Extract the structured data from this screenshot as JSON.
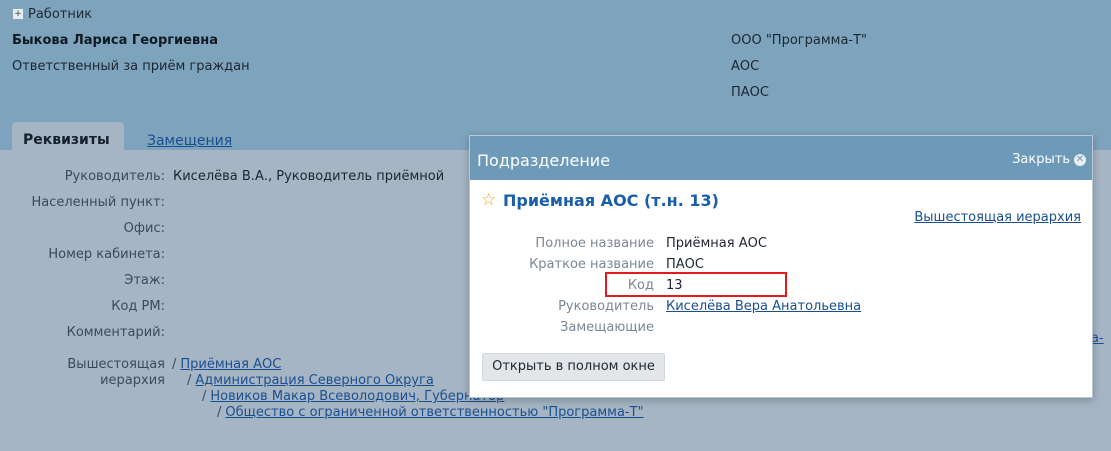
{
  "worker": {
    "toggle": "+",
    "section_title": "Работник",
    "name": "Быкова Лариса Георгиевна",
    "role": "Ответственный за приём граждан",
    "org_lines": [
      "ООО \"Программа-Т\"",
      "АОС",
      "ПАОС"
    ]
  },
  "tabs": {
    "requisites": "Реквизиты",
    "substitutions": "Замещения"
  },
  "fields": [
    {
      "label": "Руководитель:",
      "value": "Киселёва В.А., Руководитель приёмной"
    },
    {
      "label": "Населенный пункт:",
      "value": ""
    },
    {
      "label": "Офис:",
      "value": ""
    },
    {
      "label": "Номер кабинета:",
      "value": ""
    },
    {
      "label": "Этаж:",
      "value": ""
    },
    {
      "label": "Код РМ:",
      "value": ""
    },
    {
      "label": "Комментарий:",
      "value": ""
    }
  ],
  "hierarchy": {
    "label_line1": "Вышестоящая",
    "label_line2": "иерархия",
    "items": [
      "Приёмная АОС",
      "Администрация Северного Округа",
      "Новиков Макар Всеволодович, Губернатор",
      "Общество с ограниченной ответственностью \"Программа-Т\""
    ],
    "separator": "/"
  },
  "right_clip_text": "a-",
  "dialog": {
    "title": "Подразделение",
    "close_label": "Закрыть",
    "close_glyph": "✕",
    "star_glyph": "☆",
    "dept_title": "Приёмная АОС (т.н. 13)",
    "hierarchy_link": "Вышестоящая иерархия",
    "rows": [
      {
        "label": "Полное название",
        "value": "Приёмная АОС"
      },
      {
        "label": "Краткое название",
        "value": "ПАОС"
      },
      {
        "label": "Код",
        "value": "13"
      },
      {
        "label": "Руководитель",
        "value": "Киселёва Вера Анатольевна"
      },
      {
        "label": "Замещающие",
        "value": ""
      }
    ],
    "open_full_button": "Открыть в полном окне"
  }
}
